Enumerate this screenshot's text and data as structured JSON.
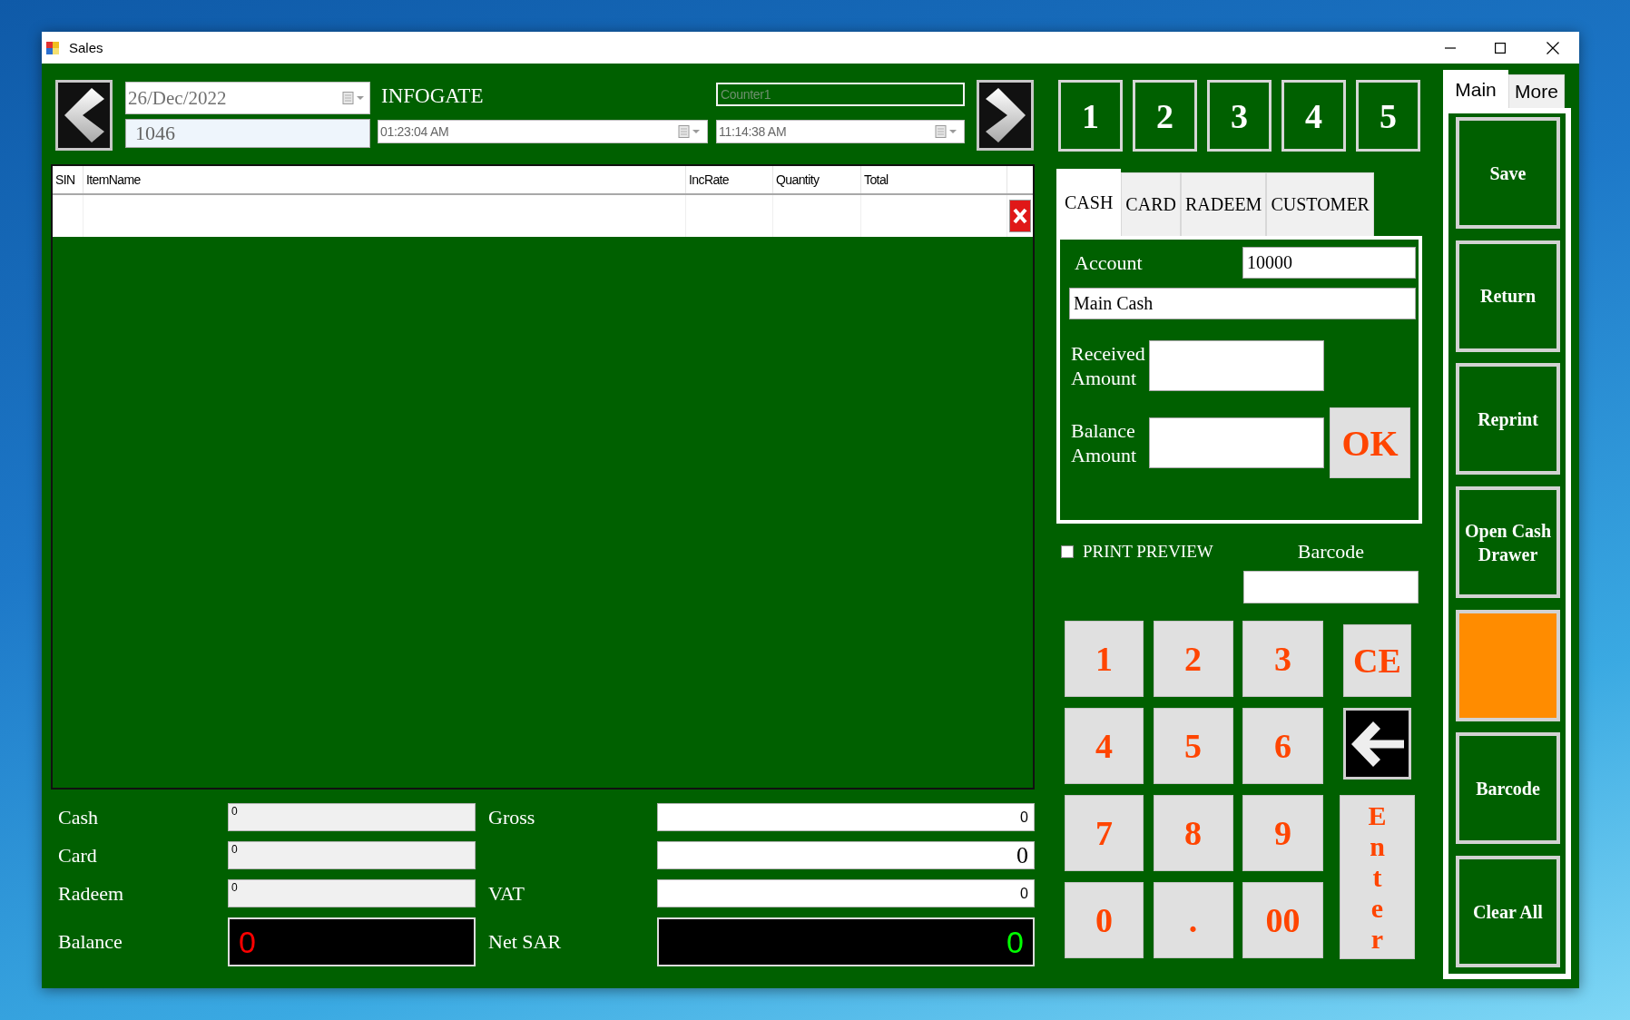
{
  "window": {
    "title": "Sales"
  },
  "header": {
    "date": "26/Dec/2022",
    "bill_number": "1046",
    "company": "INFOGATE",
    "counter": {
      "value": "Counter1",
      "disabled": true
    },
    "times": [
      "01:23:04 AM",
      "11:14:38 AM"
    ]
  },
  "table": {
    "columns": [
      "SIN",
      "ItemName",
      "IncRate",
      "Quantity",
      "Total"
    ]
  },
  "summary": {
    "left": [
      {
        "label": "Cash",
        "value": "0",
        "kind": "field"
      },
      {
        "label": "Card",
        "value": "0",
        "kind": "field"
      },
      {
        "label": "Radeem",
        "value": "0",
        "kind": "field"
      },
      {
        "label": "Balance",
        "value": "0",
        "kind": "display",
        "color": "#ff0000"
      }
    ],
    "right": [
      {
        "label": "Gross",
        "value": "0",
        "kind": "field"
      },
      {
        "value": "0",
        "kind": "field_large"
      },
      {
        "label": "VAT",
        "value": "0",
        "kind": "field"
      },
      {
        "label": "Net SAR",
        "value": "0",
        "kind": "display",
        "color": "#00ff00"
      }
    ]
  },
  "hold_buttons": [
    "1",
    "2",
    "3",
    "4",
    "5"
  ],
  "payment_tabs": [
    {
      "label": "CASH",
      "selected": true
    },
    {
      "label": "CARD",
      "selected": false
    },
    {
      "label": "RADEEM",
      "selected": false
    },
    {
      "label": "CUSTOMER",
      "selected": false
    }
  ],
  "cash_panel": {
    "account_label": "Account",
    "account_code": "10000",
    "account_name": "Main Cash",
    "received_label": "Received Amount",
    "balance_label": "Balance Amount",
    "ok_button": "OK"
  },
  "print_preview": {
    "label": "PRINT PREVIEW",
    "checked": false
  },
  "barcode": {
    "label": "Barcode"
  },
  "keypad": {
    "keys": [
      "1",
      "2",
      "3",
      "4",
      "5",
      "6",
      "7",
      "8",
      "9",
      "0",
      ".",
      "00"
    ],
    "side_keys": [
      {
        "kind": "clear",
        "label": "CE"
      },
      {
        "kind": "backspace"
      },
      {
        "kind": "enter",
        "label": "Enter"
      }
    ]
  },
  "side_tabs": [
    {
      "label": "Main",
      "selected": true
    },
    {
      "label": "More",
      "selected": false
    }
  ],
  "actions": [
    {
      "label": "Save",
      "color": "#006000"
    },
    {
      "label": "Return",
      "color": "#006000"
    },
    {
      "label": "Reprint",
      "color": "#006000"
    },
    {
      "label": "Open Cash Drawer",
      "color": "#006000"
    },
    {
      "color": "#ff8c00"
    },
    {
      "label": "Barcode",
      "color": "#006000"
    },
    {
      "label": "Clear All",
      "color": "#006000"
    }
  ]
}
